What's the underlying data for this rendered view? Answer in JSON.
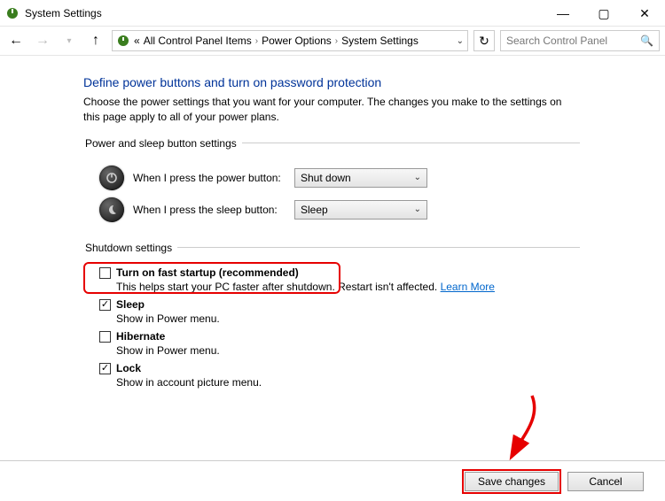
{
  "window": {
    "title": "System Settings",
    "minimize": "—",
    "maximize": "▢",
    "close": "✕"
  },
  "breadcrumb": {
    "lead": "«",
    "items": [
      "All Control Panel Items",
      "Power Options",
      "System Settings"
    ]
  },
  "search": {
    "placeholder": "Search Control Panel"
  },
  "page": {
    "heading": "Define power buttons and turn on password protection",
    "desc": "Choose the power settings that you want for your computer. The changes you make to the settings on this page apply to all of your power plans."
  },
  "section1": {
    "legend": "Power and sleep button settings",
    "powerLabel": "When I press the power button:",
    "powerValue": "Shut down",
    "sleepLabel": "When I press the sleep button:",
    "sleepValue": "Sleep"
  },
  "section2": {
    "legend": "Shutdown settings",
    "fast": {
      "label": "Turn on fast startup (recommended)",
      "sub": "This helps start your PC faster after shutdown. Restart isn't affected.",
      "learn": "Learn More",
      "checked": false
    },
    "sleep": {
      "label": "Sleep",
      "sub": "Show in Power menu.",
      "checked": true
    },
    "hibernate": {
      "label": "Hibernate",
      "sub": "Show in Power menu.",
      "checked": false
    },
    "lock": {
      "label": "Lock",
      "sub": "Show in account picture menu.",
      "checked": true
    }
  },
  "footer": {
    "save": "Save changes",
    "cancel": "Cancel"
  }
}
